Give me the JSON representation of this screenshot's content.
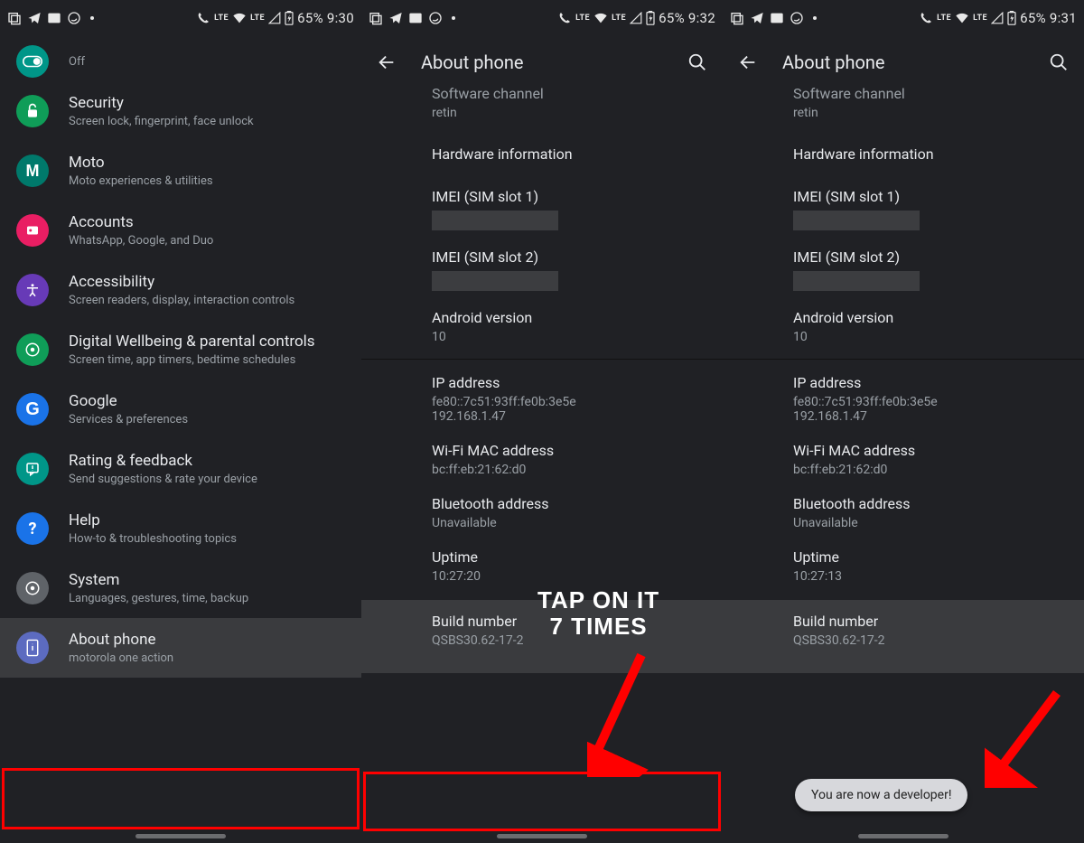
{
  "statusBar": {
    "battery": "65%",
    "lte": "LTE"
  },
  "screen1": {
    "time": "9:30",
    "offLabel": "Off",
    "items": [
      {
        "key": "security",
        "title": "Security",
        "sub": "Screen lock, fingerprint, face unlock",
        "iconBg": "#0f9d58"
      },
      {
        "key": "moto",
        "title": "Moto",
        "sub": "Moto experiences & utilities",
        "iconBg": "#00796b"
      },
      {
        "key": "accounts",
        "title": "Accounts",
        "sub": "WhatsApp, Google, and Duo",
        "iconBg": "#e91e63"
      },
      {
        "key": "accessibility",
        "title": "Accessibility",
        "sub": "Screen readers, display, interaction controls",
        "iconBg": "#673ab7"
      },
      {
        "key": "wellbeing",
        "title": "Digital Wellbeing & parental controls",
        "sub": "Screen time, app timers, bedtime schedules",
        "iconBg": "#0f9d58"
      },
      {
        "key": "google",
        "title": "Google",
        "sub": "Services & preferences",
        "iconBg": "#1a73e8"
      },
      {
        "key": "rating",
        "title": "Rating & feedback",
        "sub": "Send suggestions & rate your device",
        "iconBg": "#009688"
      },
      {
        "key": "help",
        "title": "Help",
        "sub": "How-to & troubleshooting topics",
        "iconBg": "#1a73e8"
      },
      {
        "key": "system",
        "title": "System",
        "sub": "Languages, gestures, time, backup",
        "iconBg": "#5f6368"
      },
      {
        "key": "about",
        "title": "About phone",
        "sub": "motorola one action",
        "iconBg": "#5c6bc0"
      }
    ]
  },
  "screen2": {
    "time": "9:32",
    "header": "About phone",
    "softwareChannel": {
      "title": "Software channel",
      "sub": "retin"
    },
    "hardwareInfo": "Hardware information",
    "imei1": "IMEI (SIM slot 1)",
    "imei2": "IMEI (SIM slot 2)",
    "androidVersion": {
      "title": "Android version",
      "sub": "10"
    },
    "ip": {
      "title": "IP address",
      "sub1": "fe80::7c51:93ff:fe0b:3e5e",
      "sub2": "192.168.1.47"
    },
    "wifi": {
      "title": "Wi-Fi MAC address",
      "sub": "bc:ff:eb:21:62:d0"
    },
    "bt": {
      "title": "Bluetooth address",
      "sub": "Unavailable"
    },
    "uptime": {
      "title": "Uptime",
      "sub": "10:27:20"
    },
    "build": {
      "title": "Build number",
      "sub": "QSBS30.62-17-2"
    },
    "annotationLine1": "TAP ON IT",
    "annotationLine2": "7 TIMES"
  },
  "screen3": {
    "time": "9:31",
    "header": "About phone",
    "softwareChannel": {
      "title": "Software channel",
      "sub": "retin"
    },
    "hardwareInfo": "Hardware information",
    "imei1": "IMEI (SIM slot 1)",
    "imei2": "IMEI (SIM slot 2)",
    "androidVersion": {
      "title": "Android version",
      "sub": "10"
    },
    "ip": {
      "title": "IP address",
      "sub1": "fe80::7c51:93ff:fe0b:3e5e",
      "sub2": "192.168.1.47"
    },
    "wifi": {
      "title": "Wi-Fi MAC address",
      "sub": "bc:ff:eb:21:62:d0"
    },
    "bt": {
      "title": "Bluetooth address",
      "sub": "Unavailable"
    },
    "uptime": {
      "title": "Uptime",
      "sub": "10:27:13"
    },
    "build": {
      "title": "Build number",
      "sub": "QSBS30.62-17-2"
    },
    "toast": "You are now a developer!"
  }
}
